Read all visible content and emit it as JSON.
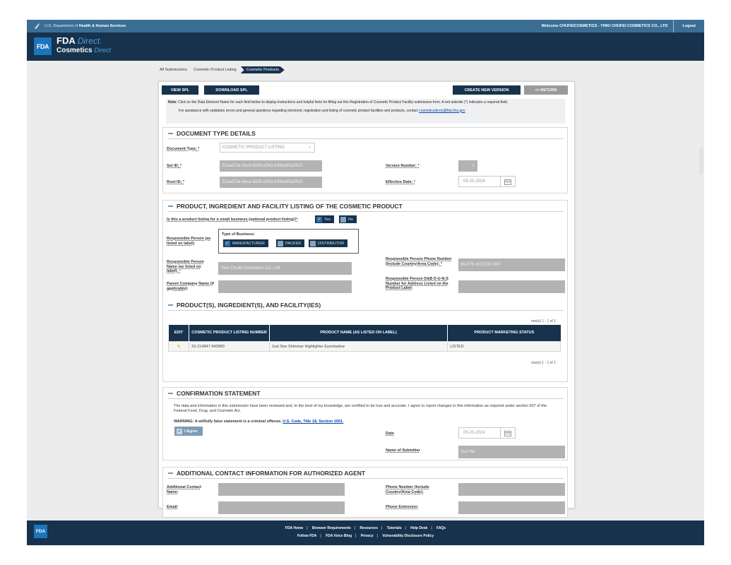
{
  "header": {
    "department_prefix": "U.S. Department of ",
    "department_bold": "Health & Human Services",
    "welcome": "Welcome CHUFEICOSMETICS - YIWU CHUFEI COSMETICS CO., LTD",
    "logout": "Logout",
    "fda_logo": "FDA",
    "brand_line1_bold": "FDA",
    "brand_line1_italic": "Direct.",
    "brand_line2_bold": "Cosmetics",
    "brand_line2_italic": "Direct"
  },
  "breadcrumbs": [
    "All Submissions",
    "Cosmetic Product Listing",
    "Cosmetic Products"
  ],
  "toolbar": {
    "view_spl": "VIEW SPL",
    "download_spl": "DOWNLOAD SPL",
    "create_new_version": "CREATE NEW VERSION",
    "return": "<< RETURN"
  },
  "note": {
    "label": "Note:",
    "text": " Click on the Data Element Name for each field below to display instructions and helpful hints for filling out this Registration of Cosmetic Product Facility submission form. A red asterisk (",
    "asterisk": "*",
    "text_end": ") indicates a required field.",
    "assist_text": "For assistance with validation errors and general questions regarding electronic registration and listing of cosmetic product facilities and products, contact ",
    "assist_email": "cosmeticsdirect@fda.hhs.gov"
  },
  "document_type": {
    "title": "DOCUMENT TYPE DETAILS",
    "document_type_label": "Document Type:",
    "document_type_value": "COSMETIC PRODUCT LISTING",
    "set_id_label": "Set ID:",
    "set_id_value": "22ead73e-0ecd-62d5-e063-6394a90a2610",
    "root_id_label": "Root ID:",
    "root_id_value": "22ead73e-0ece-62d5-e063-6394a90a2610",
    "version_label": "Version Number:",
    "version_value": "1",
    "effective_date_label": "Effective Date:",
    "effective_date_value": "09-25-2024"
  },
  "listing": {
    "title": "PRODUCT, INGREDIENT AND FACILITY LISTING OF THE COSMETIC PRODUCT",
    "small_business_label": "Is this a product listing for a small business (optional product listing)?:",
    "yes_label": "Yes",
    "no_label": "No",
    "responsible_person_label": "Responsible Person (as listed on label):",
    "type_of_business_label": "Type of Business:",
    "business_options": [
      "MANUFACTURER",
      "PACKER",
      "DISTRIBUTOR"
    ],
    "rp_name_label": "Responsible Person Name (as listed on label):",
    "rp_name_value": "Yiwu Chufei Cosmetics Co., Ltd.",
    "rp_phone_label": "Responsible Person Phone Number (Include Country/Area Code):",
    "rp_phone_value": "86-579-15372917907",
    "parent_company_label": "Parent Company Name (if applicable):",
    "duns_label": "Responsible Person D&B D-U-N-S Number for Address Listed on the Product Label:"
  },
  "products": {
    "title": "PRODUCT(S), INGREDIENT(S), AND FACILITY(IES)",
    "rows_top": "row(s) 1 - 1 of 1",
    "rows_bottom": "row(s) 1 - 1 of 1",
    "columns": [
      "EDIT",
      "COSMETIC PRODUCT LISTING NUMBER",
      "PRODUCT NAME (AS LISTED ON LABEL)",
      "PRODUCT MARKETING STATUS"
    ],
    "rows": [
      {
        "listing_number": "53-214847-943980",
        "product_name": "Just Star Shimmer Highlighter Eyeshadow",
        "status": "LISTED"
      }
    ]
  },
  "confirmation": {
    "title": "CONFIRMATION STATEMENT",
    "statement": "The data and information in this submission have been reviewed and, to the best of my knowledge, are certified to be true and accurate. I agree to report changes to this information as required under section 607 of the Federal Food, Drug, and Cosmetic Act.",
    "warning_text": "WARNING: A willfully false statement is a criminal offense, ",
    "warning_link": "U.S. Code, Title 18, Section 1001.",
    "agree_label": "I Agree",
    "date_label": "Date",
    "date_value": "09-25-2024",
    "submitter_label": "Name of Submitter",
    "submitter_value": "Sun He"
  },
  "agent": {
    "title": "ADDITIONAL CONTACT INFORMATION FOR AUTHORIZED AGENT",
    "contact_name_label": "Additional Contact Name:",
    "phone_label": "Phone Number (Include Country/Area Code):",
    "email_label": "Email:",
    "extension_label": "Phone Extension:"
  },
  "footer": {
    "logo": "FDA",
    "links_row1": [
      "FDA Home",
      "Browser Requirements",
      "Resources",
      "Tutorials",
      "Help Desk",
      "FAQs"
    ],
    "links_row2": [
      "Follow FDA",
      "FDA Voice Blog",
      "Privacy",
      "Vulnerability Disclosure Policy"
    ]
  }
}
